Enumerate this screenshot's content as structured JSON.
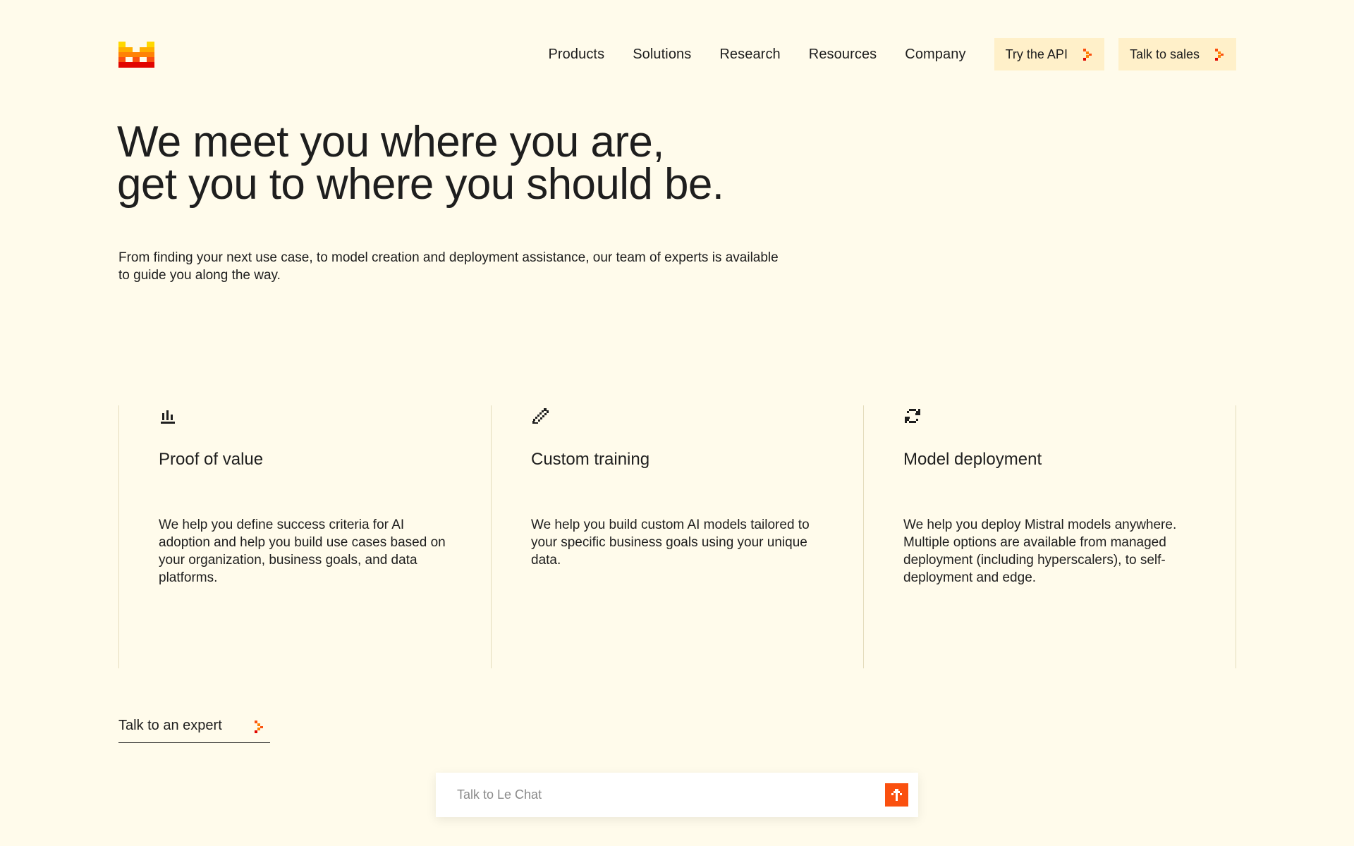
{
  "brand": {
    "logo_icon": "mistral-pixel-logo",
    "accent": "#fa500f"
  },
  "nav": {
    "links": [
      "Products",
      "Solutions",
      "Research",
      "Resources",
      "Company"
    ],
    "try_api": "Try the API",
    "talk_sales": "Talk to sales"
  },
  "hero": {
    "title_line1": "We meet you where you are,",
    "title_line2": "get you to where you should be.",
    "subtitle": "From finding your next use case, to model creation and deployment assistance, our team of experts is available to guide you along the way."
  },
  "services": [
    {
      "icon": "bar-chart-icon",
      "title": "Proof of value",
      "text": "We help you define success criteria for AI adoption and help you build use cases based on your organization, business goals, and data platforms."
    },
    {
      "icon": "pencil-icon",
      "title": "Custom training",
      "text": "We help you build custom AI models tailored to your specific business goals using your unique data."
    },
    {
      "icon": "refresh-icon",
      "title": "Model deployment",
      "text": "We help you deploy Mistral models anywhere. Multiple options are available from managed deployment (including hyperscalers), to self-deployment and edge."
    }
  ],
  "expert_link": "Talk to an expert",
  "chat": {
    "placeholder": "Talk to Le Chat"
  }
}
